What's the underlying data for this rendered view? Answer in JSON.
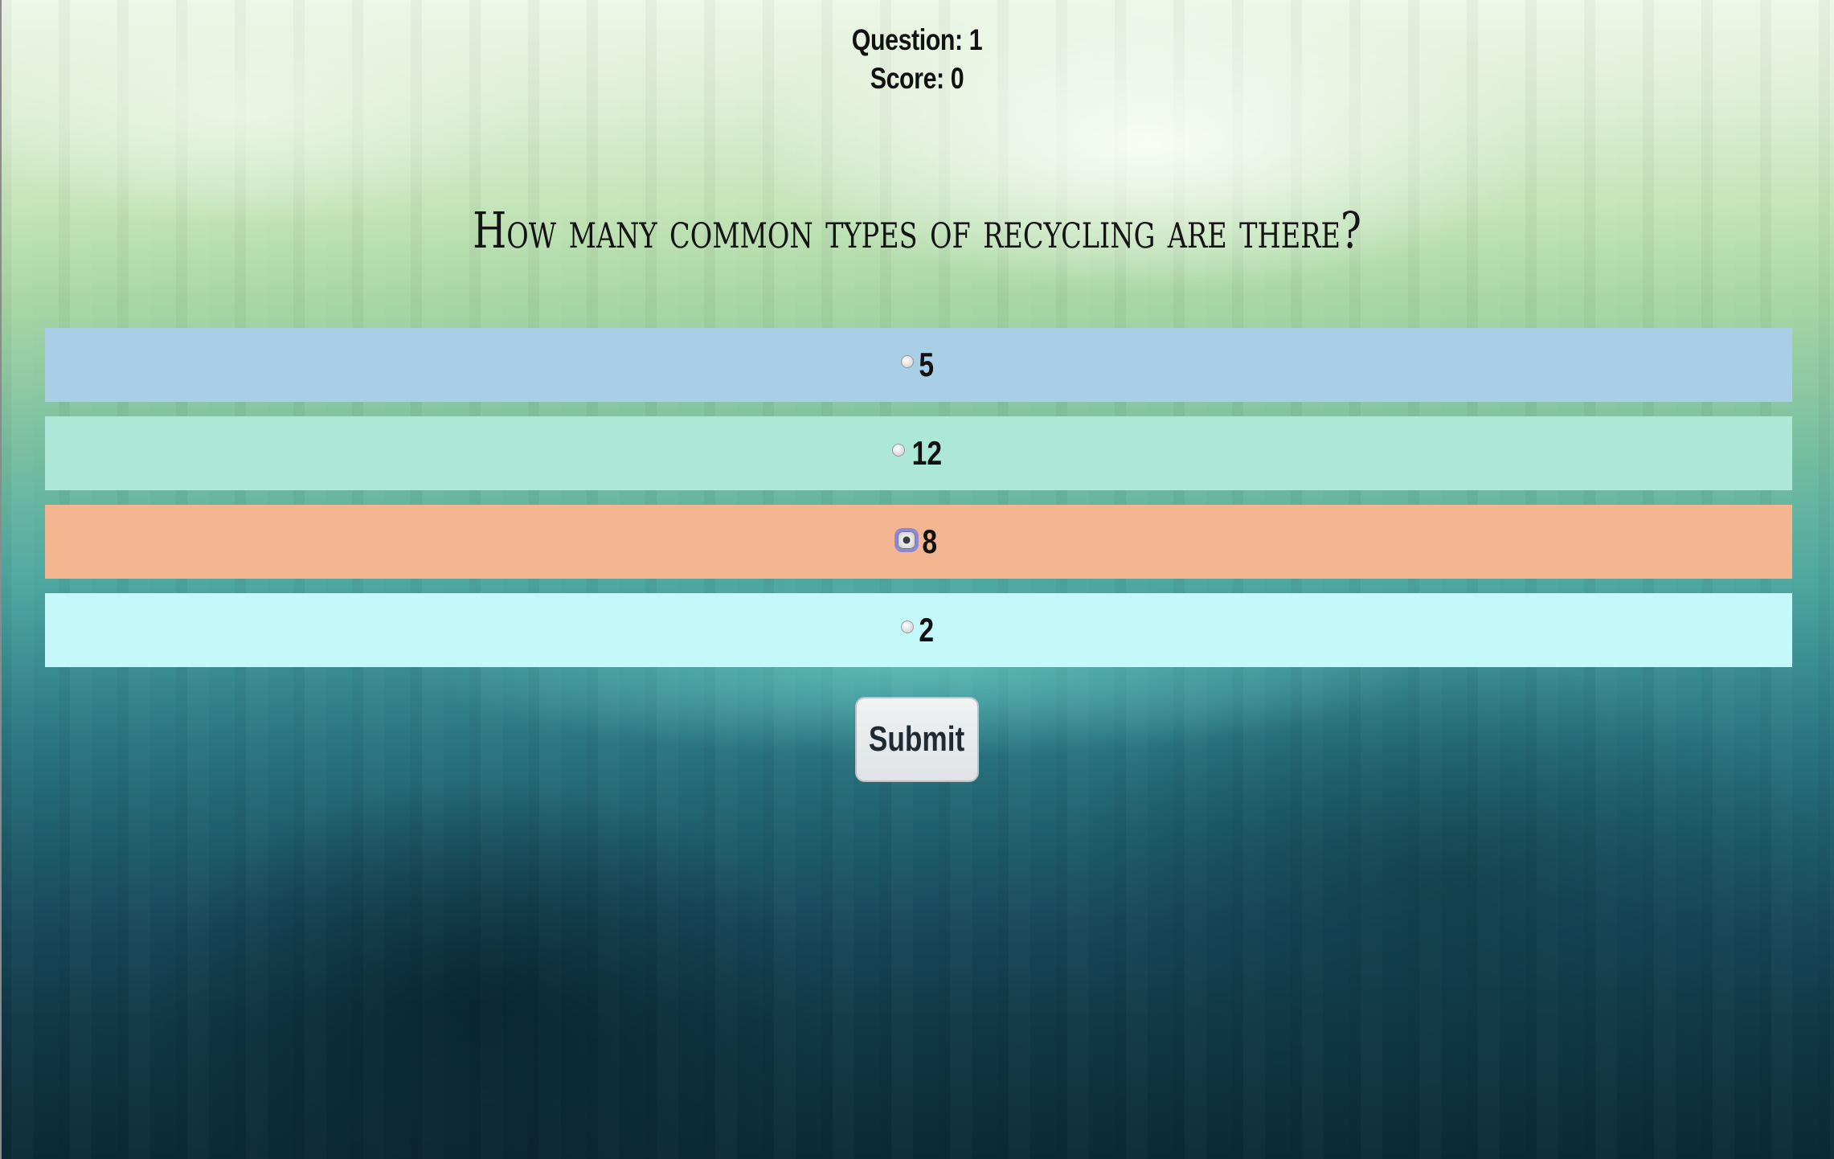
{
  "status": {
    "question_label": "Question: 1",
    "score_label": "Score: 0"
  },
  "question": {
    "text": "How many common types of recycling are there?"
  },
  "answers": [
    {
      "label": "5",
      "color": "#a9cfe6",
      "selected": false
    },
    {
      "label": "12",
      "color": "#ade8d7",
      "selected": false
    },
    {
      "label": "8",
      "color": "#f4b591",
      "selected": true
    },
    {
      "label": "2",
      "color": "#c4f8fa",
      "selected": false
    }
  ],
  "submit": {
    "label": "Submit"
  }
}
